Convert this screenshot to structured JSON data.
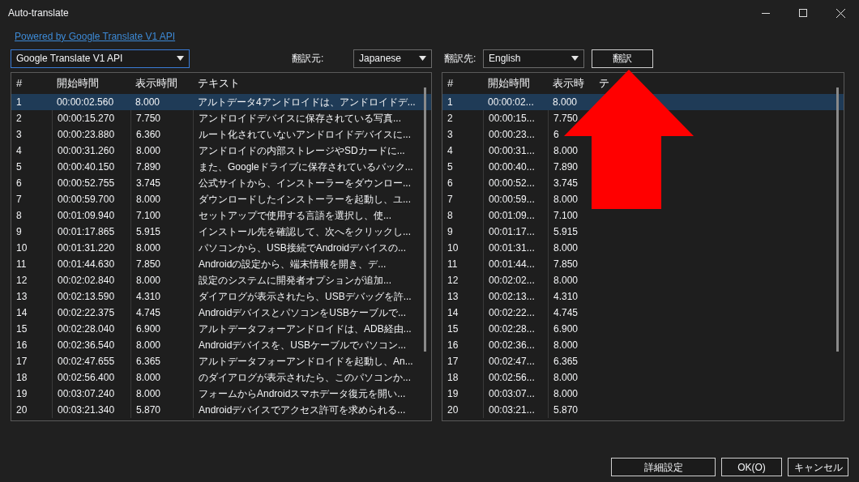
{
  "window": {
    "title": "Auto-translate"
  },
  "powered_link": "Powered by Google Translate V1 API",
  "engine_select": {
    "value": "Google Translate V1 API",
    "focused": true
  },
  "source_language": {
    "label": "翻訳元:",
    "value": "Japanese"
  },
  "target_language": {
    "label": "翻訳先:",
    "value": "English"
  },
  "translate_button": "翻訳",
  "source_table": {
    "columns": [
      "#",
      "開始時間",
      "表示時間",
      "テキスト"
    ],
    "rows": [
      {
        "cells": [
          "1",
          "00:00:02.560",
          "8.000",
          "アルトデータ4アンドロイドは、アンドロイドデ..."
        ],
        "selected": true
      },
      {
        "cells": [
          "2",
          "00:00:15.270",
          "7.750",
          "アンドロイドデバイスに保存されている写真..."
        ],
        "selected": false
      },
      {
        "cells": [
          "3",
          "00:00:23.880",
          "6.360",
          "ルート化されていないアンドロイドデバイスに..."
        ],
        "selected": false
      },
      {
        "cells": [
          "4",
          "00:00:31.260",
          "8.000",
          "アンドロイドの内部ストレージやSDカードに..."
        ],
        "selected": false
      },
      {
        "cells": [
          "5",
          "00:00:40.150",
          "7.890",
          "また、Googleドライブに保存されているバック..."
        ],
        "selected": false
      },
      {
        "cells": [
          "6",
          "00:00:52.755",
          "3.745",
          "公式サイトから、インストーラーをダウンロー..."
        ],
        "selected": false
      },
      {
        "cells": [
          "7",
          "00:00:59.700",
          "8.000",
          "ダウンロードしたインストーラーを起動し、ユ..."
        ],
        "selected": false
      },
      {
        "cells": [
          "8",
          "00:01:09.940",
          "7.100",
          "セットアップで使用する言語を選択し、使..."
        ],
        "selected": false
      },
      {
        "cells": [
          "9",
          "00:01:17.865",
          "5.915",
          "インストール先を確認して、次へをクリックし..."
        ],
        "selected": false
      },
      {
        "cells": [
          "10",
          "00:01:31.220",
          "8.000",
          "パソコンから、USB接続でAndroidデバイスの..."
        ],
        "selected": false
      },
      {
        "cells": [
          "11",
          "00:01:44.630",
          "7.850",
          "Androidの設定から、端末情報を開き、デ..."
        ],
        "selected": false
      },
      {
        "cells": [
          "12",
          "00:02:02.840",
          "8.000",
          "設定のシステムに開発者オプションが追加..."
        ],
        "selected": false
      },
      {
        "cells": [
          "13",
          "00:02:13.590",
          "4.310",
          "ダイアログが表示されたら、USBデバッグを許..."
        ],
        "selected": false
      },
      {
        "cells": [
          "14",
          "00:02:22.375",
          "4.745",
          "AndroidデバイスとパソコンをUSBケーブルで..."
        ],
        "selected": false
      },
      {
        "cells": [
          "15",
          "00:02:28.040",
          "6.900",
          "アルトデータフォーアンドロイドは、ADB経由..."
        ],
        "selected": false
      },
      {
        "cells": [
          "16",
          "00:02:36.540",
          "8.000",
          "Androidデバイスを、USBケーブルでパソコン..."
        ],
        "selected": false
      },
      {
        "cells": [
          "17",
          "00:02:47.655",
          "6.365",
          "アルトデータフォーアンドロイドを起動し、An..."
        ],
        "selected": false
      },
      {
        "cells": [
          "18",
          "00:02:56.400",
          "8.000",
          "のダイアログが表示されたら、このパソコンか..."
        ],
        "selected": false
      },
      {
        "cells": [
          "19",
          "00:03:07.240",
          "8.000",
          "フォームからAndroidスマホデータ復元を開い..."
        ],
        "selected": false
      },
      {
        "cells": [
          "20",
          "00:03:21.340",
          "5.870",
          "Androidデバイスでアクセス許可を求められる..."
        ],
        "selected": false
      }
    ]
  },
  "target_table": {
    "columns": [
      "#",
      "開始時間",
      "表示時",
      "テ"
    ],
    "rows": [
      {
        "cells": [
          "1",
          "00:00:02...",
          "8.000"
        ],
        "selected": true
      },
      {
        "cells": [
          "2",
          "00:00:15...",
          "7.750"
        ],
        "selected": false
      },
      {
        "cells": [
          "3",
          "00:00:23...",
          "6"
        ],
        "selected": false
      },
      {
        "cells": [
          "4",
          "00:00:31...",
          "8.000"
        ],
        "selected": false
      },
      {
        "cells": [
          "5",
          "00:00:40...",
          "7.890"
        ],
        "selected": false
      },
      {
        "cells": [
          "6",
          "00:00:52...",
          "3.745"
        ],
        "selected": false
      },
      {
        "cells": [
          "7",
          "00:00:59...",
          "8.000"
        ],
        "selected": false
      },
      {
        "cells": [
          "8",
          "00:01:09...",
          "7.100"
        ],
        "selected": false
      },
      {
        "cells": [
          "9",
          "00:01:17...",
          "5.915"
        ],
        "selected": false
      },
      {
        "cells": [
          "10",
          "00:01:31...",
          "8.000"
        ],
        "selected": false
      },
      {
        "cells": [
          "11",
          "00:01:44...",
          "7.850"
        ],
        "selected": false
      },
      {
        "cells": [
          "12",
          "00:02:02...",
          "8.000"
        ],
        "selected": false
      },
      {
        "cells": [
          "13",
          "00:02:13...",
          "4.310"
        ],
        "selected": false
      },
      {
        "cells": [
          "14",
          "00:02:22...",
          "4.745"
        ],
        "selected": false
      },
      {
        "cells": [
          "15",
          "00:02:28...",
          "6.900"
        ],
        "selected": false
      },
      {
        "cells": [
          "16",
          "00:02:36...",
          "8.000"
        ],
        "selected": false
      },
      {
        "cells": [
          "17",
          "00:02:47...",
          "6.365"
        ],
        "selected": false
      },
      {
        "cells": [
          "18",
          "00:02:56...",
          "8.000"
        ],
        "selected": false
      },
      {
        "cells": [
          "19",
          "00:03:07...",
          "8.000"
        ],
        "selected": false
      },
      {
        "cells": [
          "20",
          "00:03:21...",
          "5.870"
        ],
        "selected": false
      }
    ]
  },
  "footer_buttons": [
    "詳細設定",
    "OK(O)",
    "キャンセル"
  ]
}
